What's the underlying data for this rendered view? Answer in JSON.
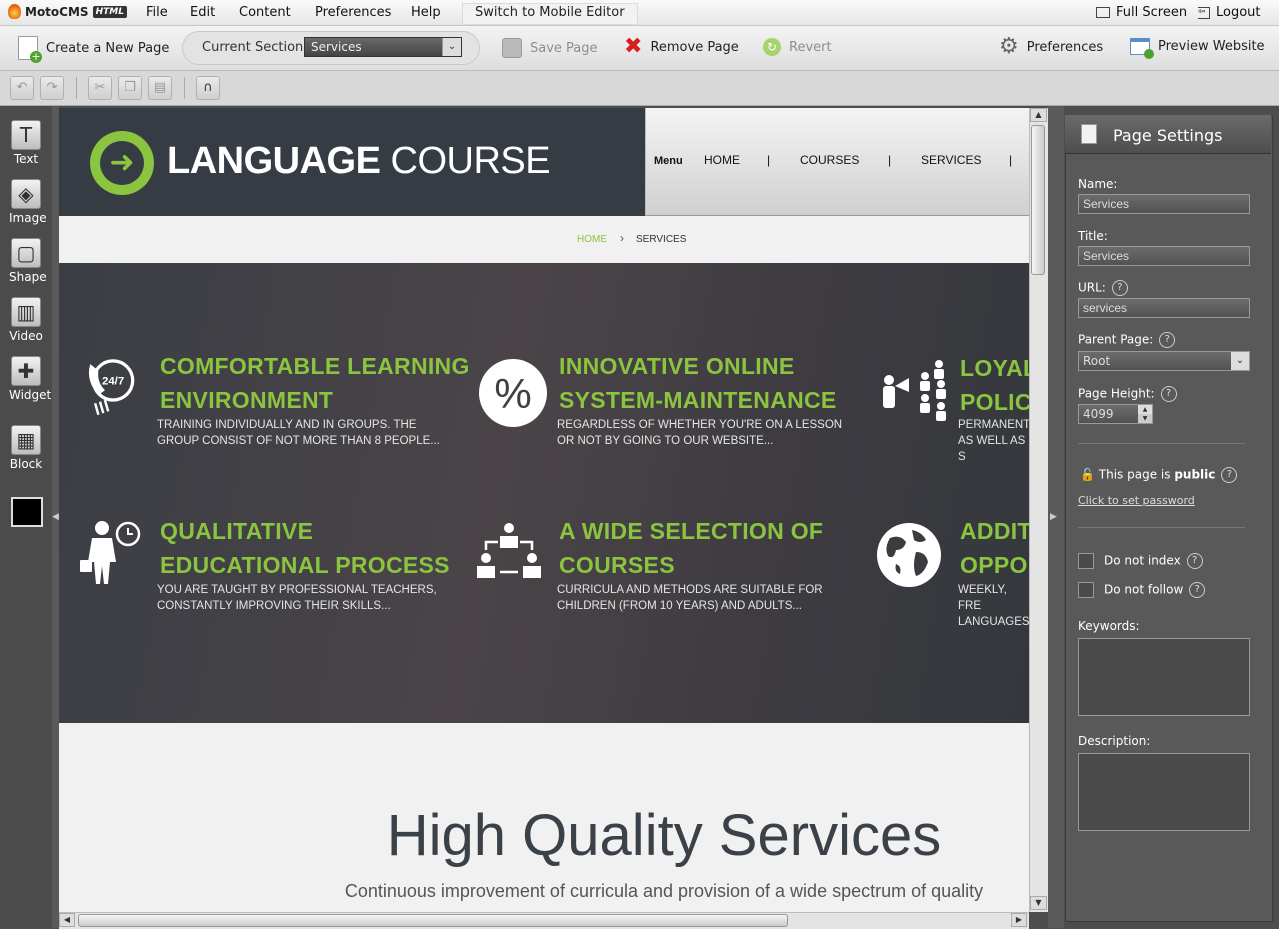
{
  "menubar": {
    "logo_text": "MotoCMS",
    "logo_badge": "HTML",
    "items": [
      "File",
      "Edit",
      "Content",
      "Preferences",
      "Help"
    ],
    "switch_mobile": "Switch to Mobile Editor",
    "fullscreen": "Full Screen",
    "logout": "Logout"
  },
  "toolbar": {
    "create_page": "Create a New Page",
    "current_section_label": "Current Section:",
    "current_section_value": "Services",
    "save_page": "Save Page",
    "remove_page": "Remove Page",
    "revert": "Revert",
    "preferences": "Preferences",
    "preview_website": "Preview Website"
  },
  "left_tools": [
    "Text",
    "Image",
    "Shape",
    "Video",
    "Widget",
    "Block"
  ],
  "site": {
    "logo_bold": "LANGUAGE",
    "logo_light": "COURSE",
    "nav": {
      "menu_label": "Menu",
      "items": [
        "HOME",
        "COURSES",
        "SERVICES"
      ],
      "separator": "|"
    },
    "breadcrumb": {
      "home": "HOME",
      "sep": "›",
      "current": "SERVICES"
    },
    "features": [
      {
        "icon": "phone-24-7-icon",
        "title": "COMFORTABLE LEARNING\nENVIRONMENT",
        "text": "TRAINING INDIVIDUALLY AND IN GROUPS. THE\nGROUP CONSIST OF NOT MORE THAN 8 PEOPLE..."
      },
      {
        "icon": "percent-icon",
        "title": "INNOVATIVE ONLINE\nSYSTEM-MAINTENANCE",
        "text": "REGARDLESS OF WHETHER YOU'RE ON A LESSON\nOR NOT BY GOING TO OUR WEBSITE..."
      },
      {
        "icon": "megaphone-crowd-icon",
        "title": "LOYAL\nPOLIC",
        "text": "PERMANENT\nAS WELL AS S"
      },
      {
        "icon": "businessman-clock-icon",
        "title": "QUALITATIVE\nEDUCATIONAL PROCESS",
        "text": "YOU ARE TAUGHT BY PROFESSIONAL TEACHERS,\nCONSTANTLY IMPROVING THEIR SKILLS..."
      },
      {
        "icon": "people-exchange-icon",
        "title": "A WIDE SELECTION OF\nCOURSES",
        "text": "CURRICULA AND METHODS ARE SUITABLE FOR\nCHILDREN (FROM 10 YEARS) AND ADULTS..."
      },
      {
        "icon": "globe-icon",
        "title": "ADDIT\nOPPO",
        "text": "WEEKLY, FRE\nLANGUAGES"
      }
    ],
    "hq_title": "High Quality Services",
    "hq_subtitle": "Continuous improvement of curricula and provision of a wide spectrum of quality"
  },
  "page_settings": {
    "title": "Page Settings",
    "name_label": "Name:",
    "name_value": "Services",
    "title_label": "Title:",
    "title_value": "Services",
    "url_label": "URL:",
    "url_value": "services",
    "parent_label": "Parent Page:",
    "parent_value": "Root",
    "height_label": "Page Height:",
    "height_value": "4099",
    "public_text": "This page is",
    "public_value": "public",
    "set_password": "Click to set password",
    "do_not_index": "Do not index",
    "do_not_follow": "Do not follow",
    "keywords_label": "Keywords:",
    "description_label": "Description:",
    "help_glyph": "?"
  },
  "colors": {
    "accent_green": "#8bc43f",
    "header_dark": "#363c44",
    "panel_bg": "#595959"
  }
}
